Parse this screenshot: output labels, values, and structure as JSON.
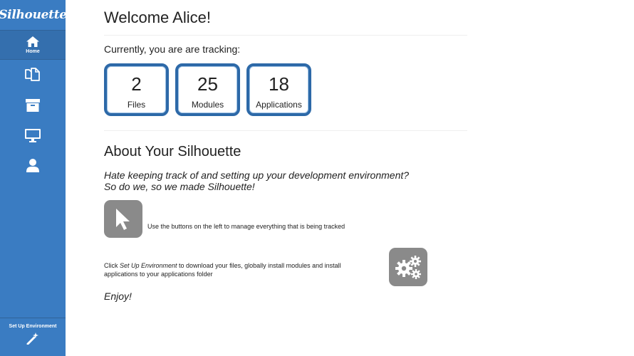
{
  "sidebar": {
    "brand": "Silhouette",
    "items": [
      {
        "name": "home",
        "label": "Home",
        "icon": "home-icon"
      },
      {
        "name": "files",
        "icon": "files-icon"
      },
      {
        "name": "modules",
        "icon": "archive-icon"
      },
      {
        "name": "applications",
        "icon": "desktop-icon"
      },
      {
        "name": "account",
        "icon": "user-icon"
      }
    ],
    "setup_label": "Set Up Environment",
    "setup_icon": "magic-wand-icon"
  },
  "main": {
    "welcome": "Welcome Alice!",
    "tracking": "Currently, you are are tracking:",
    "stats": [
      {
        "value": "2",
        "label": "Files"
      },
      {
        "value": "25",
        "label": "Modules"
      },
      {
        "value": "18",
        "label": "Applications"
      }
    ],
    "about_title": "About Your Silhouette",
    "tagline_1": "Hate keeping track of and setting up your development environment?",
    "tagline_2": "So do we, so we made Silhouette!",
    "info_1": "Use the buttons on the left to manage everything that is being tracked",
    "info_2_prefix": "Click ",
    "info_2_emph": "Set Up Environment",
    "info_2_suffix": " to download your files, globally install modules and install applications to your applications folder",
    "enjoy": "Enjoy!",
    "tile_1_icon": "cursor-icon",
    "tile_2_icon": "gears-icon"
  },
  "colors": {
    "sidebar": "#3a7cc2",
    "stat_border": "#2d69a8",
    "tile": "#8a8a8a"
  }
}
